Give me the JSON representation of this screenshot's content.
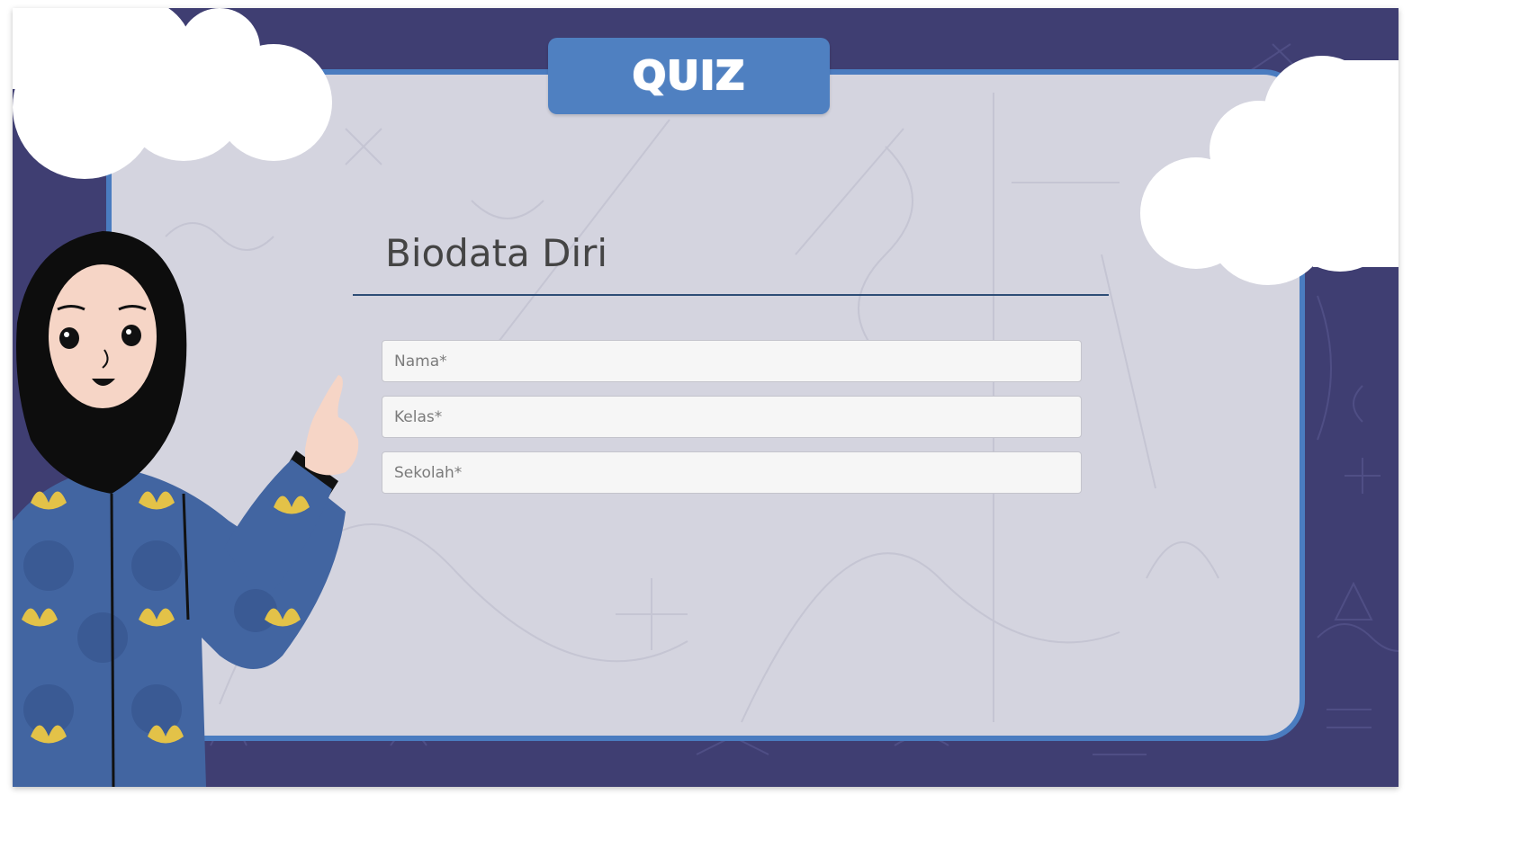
{
  "header": {
    "tab_label": "QUIZ"
  },
  "form": {
    "title": "Biodata Diri",
    "fields": [
      {
        "placeholder": "Nama*",
        "value": ""
      },
      {
        "placeholder": "Kelas*",
        "value": ""
      },
      {
        "placeholder": "Sekolah*",
        "value": ""
      }
    ]
  },
  "colors": {
    "background": "#3f3e72",
    "board": "#d4d4df",
    "board_border": "#4a7cc0",
    "tab": "#4f80c1",
    "title_rule": "#2e4d76"
  },
  "icons": {
    "character": "teacher-character-illustration",
    "clouds": "cloud-decoration"
  }
}
